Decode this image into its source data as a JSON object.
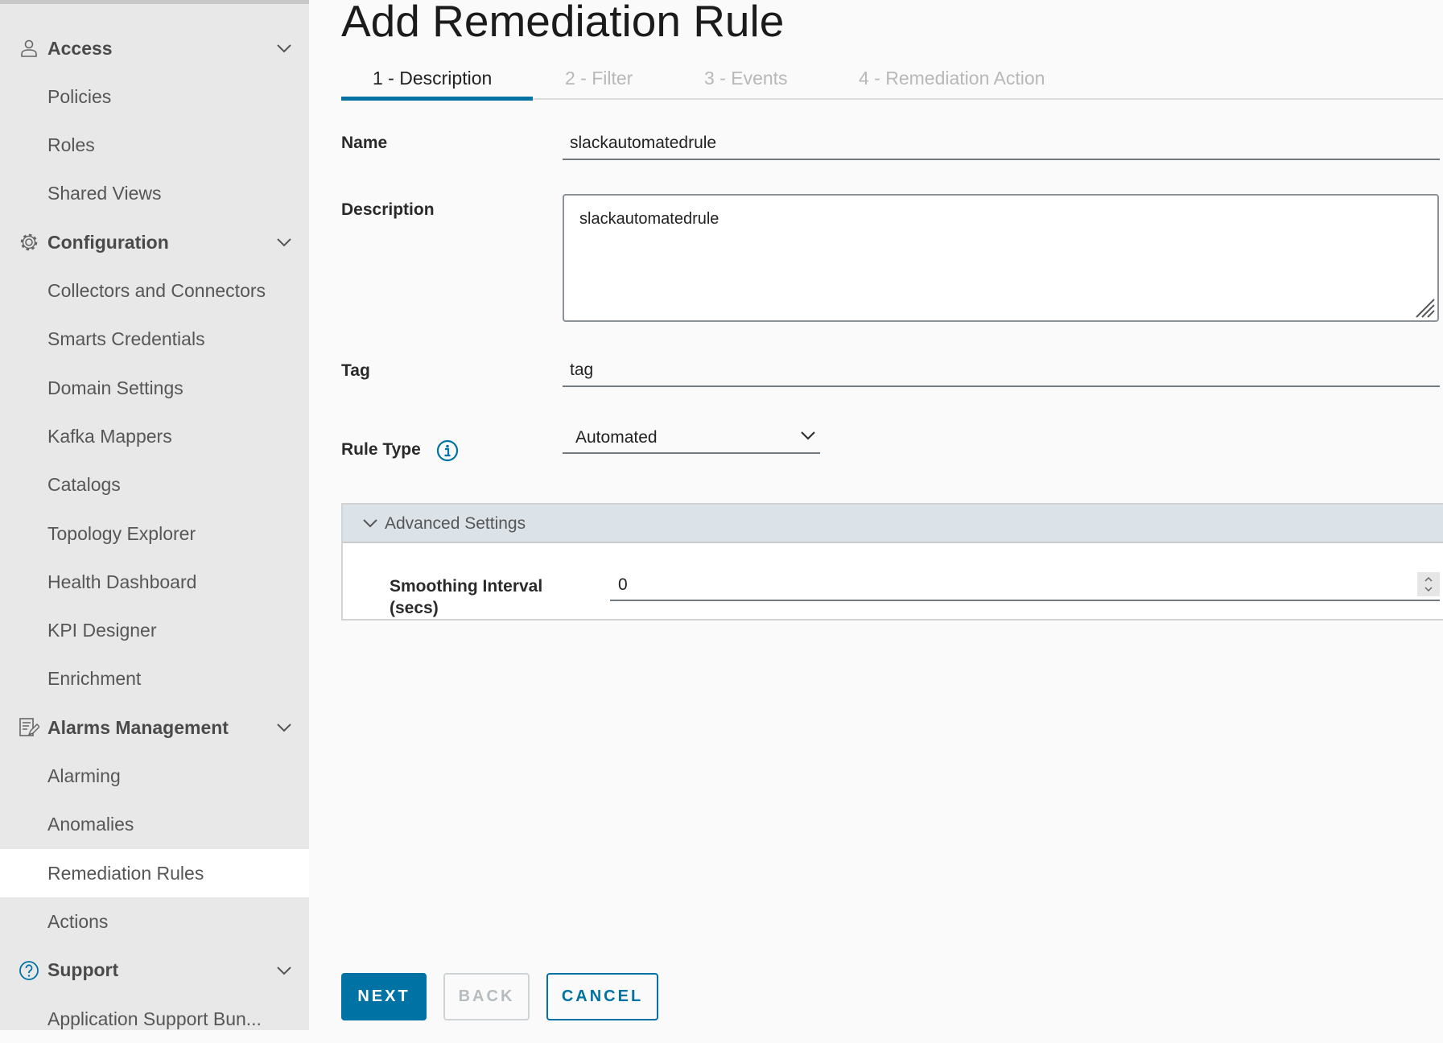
{
  "sidebar": {
    "items": [
      {
        "label": "Access",
        "group": true,
        "icon": "user-icon"
      },
      {
        "label": "Policies"
      },
      {
        "label": "Roles"
      },
      {
        "label": "Shared Views"
      },
      {
        "label": "Configuration",
        "group": true,
        "icon": "gear-icon"
      },
      {
        "label": "Collectors and Connectors"
      },
      {
        "label": "Smarts Credentials"
      },
      {
        "label": "Domain Settings"
      },
      {
        "label": "Kafka Mappers"
      },
      {
        "label": "Catalogs"
      },
      {
        "label": "Topology Explorer"
      },
      {
        "label": "Health Dashboard"
      },
      {
        "label": "KPI Designer"
      },
      {
        "label": "Enrichment"
      },
      {
        "label": "Alarms Management",
        "group": true,
        "icon": "list-edit-icon"
      },
      {
        "label": "Alarming"
      },
      {
        "label": "Anomalies"
      },
      {
        "label": "Remediation Rules",
        "active": true
      },
      {
        "label": "Actions"
      },
      {
        "label": "Support",
        "group": true,
        "icon": "help-icon"
      },
      {
        "label": "Application Support Bun..."
      }
    ]
  },
  "page": {
    "title": "Add Remediation Rule"
  },
  "tabs": [
    "1 - Description",
    "2 - Filter",
    "3 - Events",
    "4 - Remediation Action"
  ],
  "form": {
    "name_label": "Name",
    "name_value": "slackautomatedrule",
    "description_label": "Description",
    "description_value": "slackautomatedrule",
    "tag_label": "Tag",
    "tag_value": "tag",
    "rule_type_label": "Rule Type",
    "rule_type_value": "Automated",
    "advanced_label": "Advanced Settings",
    "smoothing_label_1": "Smoothing Interval",
    "smoothing_label_2": "(secs)",
    "smoothing_value": "0"
  },
  "buttons": {
    "next": "NEXT",
    "back": "BACK",
    "cancel": "CANCEL"
  },
  "colors": {
    "accent": "#0072a3",
    "sidebar_bg": "#e8e8e8",
    "advanced_header": "#dbe3e9"
  }
}
